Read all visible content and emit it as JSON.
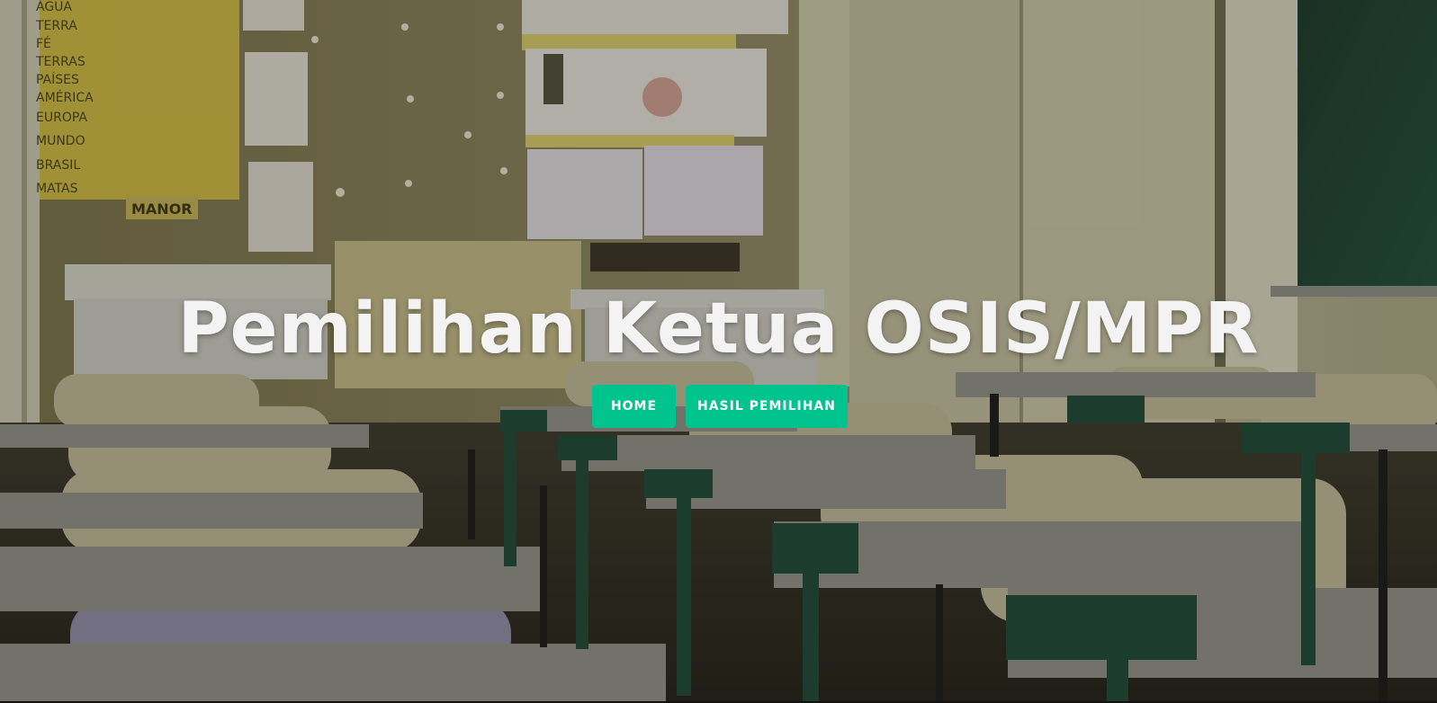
{
  "hero": {
    "title": "Pemilihan Ketua OSIS/MPR",
    "background_image": "classroom-desks-chairs-photo"
  },
  "nav": {
    "home_label": "HOME",
    "results_label": "HASIL PEMILIHAN"
  },
  "colors": {
    "accent": "#00c38e",
    "title_text": "#f3f3f3",
    "button_text": "#ffffff"
  },
  "poster": {
    "lines": [
      "ÁGUA",
      "TERRA",
      "FÉ",
      "TERRAS",
      "PAÍSES",
      "AMÉRICA",
      "EUROPA",
      "MUNDO",
      "BRASIL",
      "MATAS"
    ],
    "tag": "MANOR"
  }
}
